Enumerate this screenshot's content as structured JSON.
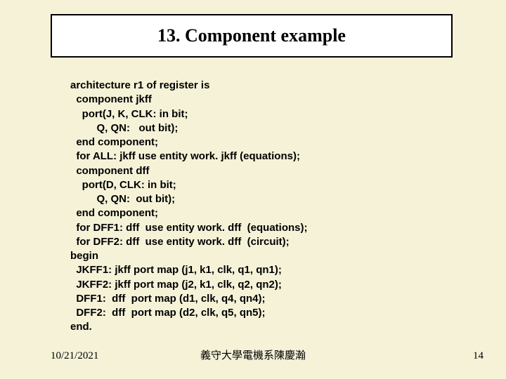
{
  "title": "13. Component example",
  "code": {
    "l01": "architecture r1 of register is",
    "l02": "  component jkff",
    "l03": "    port(J, K, CLK: in bit;",
    "l04": "         Q, QN:   out bit);",
    "l05": "  end component;",
    "l06": "  for ALL: jkff use entity work. jkff (equations);",
    "l07": "  component dff",
    "l08": "    port(D, CLK: in bit;",
    "l09": "         Q, QN:  out bit);",
    "l10": "  end component;",
    "l11": "  for DFF1: dff  use entity work. dff  (equations);",
    "l12": "  for DFF2: dff  use entity work. dff  (circuit);",
    "l13": "begin",
    "l14": "  JKFF1: jkff port map (j1, k1, clk, q1, qn1);",
    "l15": "  JKFF2: jkff port map (j2, k1, clk, q2, qn2);",
    "l16": "  DFF1:  dff  port map (d1, clk, q4, qn4);",
    "l17": "  DFF2:  dff  port map (d2, clk, q5, qn5);",
    "l18": "end."
  },
  "footer": {
    "date": "10/21/2021",
    "center": "義守大學電機系陳慶瀚",
    "page_number": "14"
  }
}
